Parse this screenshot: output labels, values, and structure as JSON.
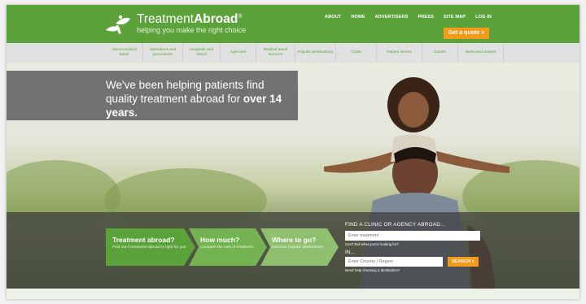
{
  "brand": {
    "name_light": "Treatment",
    "name_bold": "Abroad",
    "registered": "®",
    "tagline": "helping you make the right choice",
    "color": "#5ba23a"
  },
  "top_links": [
    "ABOUT",
    "HOME",
    "ADVERTISERS",
    "PRESS",
    "SITE MAP",
    "LOG IN"
  ],
  "quote_button": "Get a quote >",
  "nav": [
    "About medical travel",
    "Operations and procedures",
    "Hospitals and clinics",
    "Agencies",
    "Medical travel services",
    "Popular destinations",
    "Costs",
    "Patient stories",
    "Guides",
    "News and articles"
  ],
  "hero": {
    "headline_part1": "We've been helping patients find quality treatment abroad for ",
    "headline_bold": "over 14 years."
  },
  "steps": [
    {
      "title": "Treatment abroad?",
      "desc": "Find out if treatment abroad is right for you",
      "color": "#5ba23a"
    },
    {
      "title": "How much?",
      "desc": "Compare the cost of treatment",
      "color": "#74b352"
    },
    {
      "title": "Where to go?",
      "desc": "Discover popular destinations",
      "color": "#8fc06f"
    }
  ],
  "finder": {
    "title": "FIND A CLINIC OR AGENCY ABROAD...",
    "treatment_placeholder": "Enter treatment",
    "treatment_help": "Can't find what you're looking for?",
    "in_label": "IN...",
    "country_placeholder": "Enter Country / Region",
    "search_button": "SEARCH >",
    "country_help": "Need help choosing a destination?"
  },
  "colors": {
    "accent": "#f39a1a",
    "nav_bg": "#e1e1e1"
  }
}
